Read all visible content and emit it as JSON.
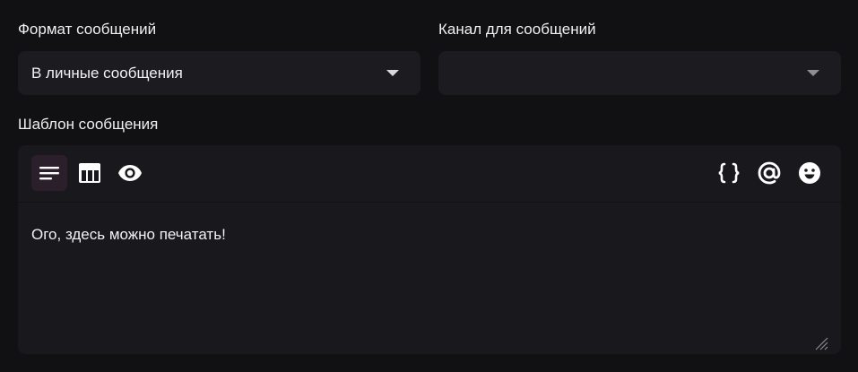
{
  "format_field": {
    "label": "Формат сообщений",
    "value": "В личные сообщения"
  },
  "channel_field": {
    "label": "Канал для сообщений",
    "value": ""
  },
  "template_field": {
    "label": "Шаблон сообщения",
    "content": "Ого, здесь можно печатать!"
  },
  "toolbar": {
    "left_tools": [
      "text-format-icon",
      "table-icon",
      "eye-icon"
    ],
    "right_tools": [
      "braces-icon",
      "at-icon",
      "emoji-icon"
    ],
    "active_tool": "text-format-icon"
  },
  "colors": {
    "background": "#111113",
    "surface": "#1b1b20",
    "active_tool_bg": "#2a1f2b",
    "text": "#f2f2f4"
  }
}
